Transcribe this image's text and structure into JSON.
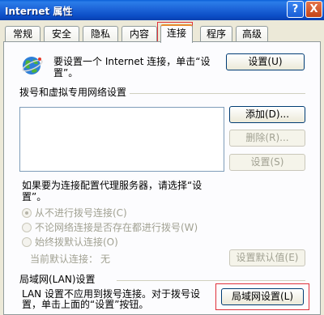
{
  "window": {
    "title": "Internet 属性",
    "help_button": "?",
    "close_button": "X"
  },
  "tabs": [
    {
      "label": "常规"
    },
    {
      "label": "安全"
    },
    {
      "label": "隐私"
    },
    {
      "label": "内容"
    },
    {
      "label": "连接",
      "active": true
    },
    {
      "label": "程序"
    },
    {
      "label": "高级"
    }
  ],
  "setup": {
    "text_line1": "要设置一个 Internet 连接，单击“设",
    "text_line2": "置”。",
    "button": "设置(U)"
  },
  "dialup": {
    "heading": "拨号和虚拟专用网络设置",
    "add_button": "添加(D)...",
    "remove_button": "删除(R)...",
    "settings_button": "设置(S)"
  },
  "proxy_note": {
    "line1": "如果要为连接配置代理服务器，请选择“设",
    "line2": "置”。"
  },
  "dial_options": [
    {
      "label": "从不进行拨号连接(C)",
      "selected": true
    },
    {
      "label": "不论网络连接是否存在都进行拨号(W)",
      "selected": false
    },
    {
      "label": "始终拨默认连接(O)",
      "selected": false
    }
  ],
  "default_connection": {
    "label": "当前默认连接：",
    "value": "无",
    "button": "设置默认值(E)"
  },
  "lan": {
    "heading": "局域网(LAN)设置",
    "text_line1": "LAN 设置不应用到拨号连接。对于拨号设",
    "text_line2": "置，单击上面的“设置”按钮。",
    "button": "局域网设置(L)"
  },
  "colors": {
    "titlebar": "#0a5fd8",
    "dialog_bg": "#ece9d8",
    "highlight_box": "#e0303a"
  }
}
